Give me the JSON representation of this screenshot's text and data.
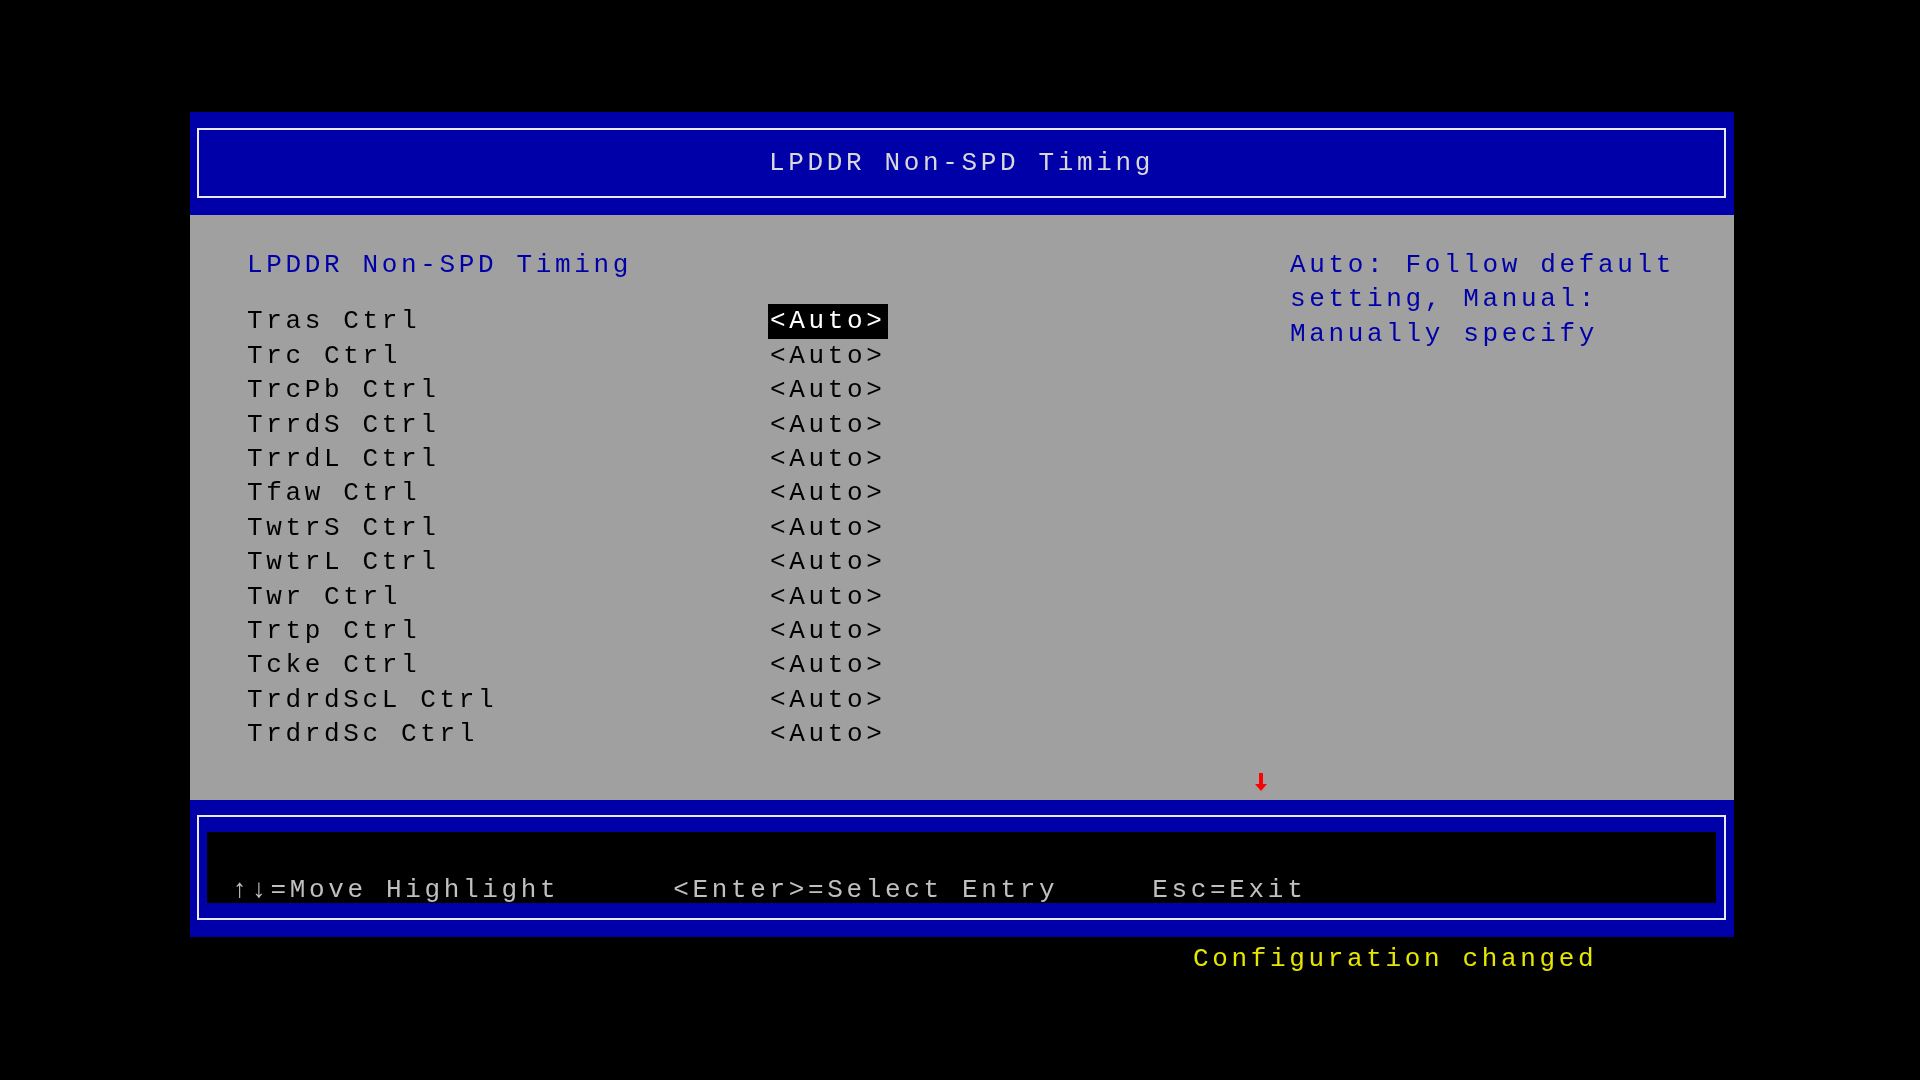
{
  "window": {
    "title": "LPDDR Non-SPD Timing"
  },
  "page": {
    "heading": "LPDDR Non-SPD Timing",
    "items": [
      {
        "label": "Tras Ctrl",
        "value": "<Auto>",
        "selected": true
      },
      {
        "label": "Trc Ctrl",
        "value": "<Auto>",
        "selected": false
      },
      {
        "label": "TrcPb Ctrl",
        "value": "<Auto>",
        "selected": false
      },
      {
        "label": "TrrdS Ctrl",
        "value": "<Auto>",
        "selected": false
      },
      {
        "label": "TrrdL Ctrl",
        "value": "<Auto>",
        "selected": false
      },
      {
        "label": "Tfaw Ctrl",
        "value": "<Auto>",
        "selected": false
      },
      {
        "label": "TwtrS Ctrl",
        "value": "<Auto>",
        "selected": false
      },
      {
        "label": "TwtrL Ctrl",
        "value": "<Auto>",
        "selected": false
      },
      {
        "label": "Twr Ctrl",
        "value": "<Auto>",
        "selected": false
      },
      {
        "label": "Trtp Ctrl",
        "value": "<Auto>",
        "selected": false
      },
      {
        "label": "Tcke Ctrl",
        "value": "<Auto>",
        "selected": false
      },
      {
        "label": "TrdrdScL Ctrl",
        "value": "<Auto>",
        "selected": false
      },
      {
        "label": "TrdrdSc Ctrl",
        "value": "<Auto>",
        "selected": false
      }
    ],
    "help": "Auto: Follow default setting, Manual: Manually specify"
  },
  "footer": {
    "hints": [
      "↑↓=Move Highlight",
      "<Enter>=Select Entry",
      "Esc=Exit"
    ]
  },
  "status_message": "Configuration changed"
}
